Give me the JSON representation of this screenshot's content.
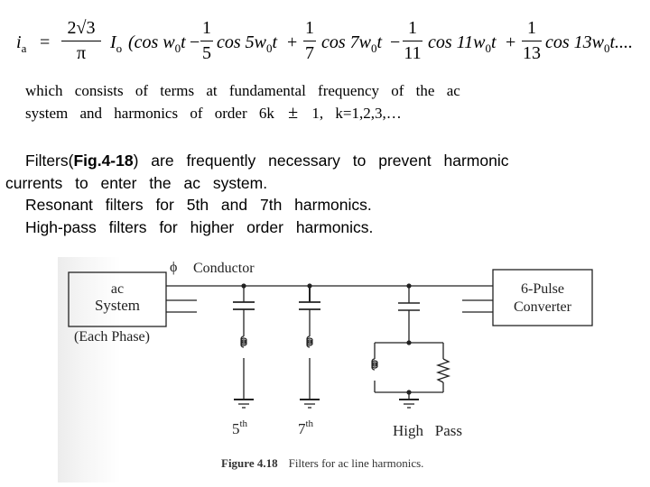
{
  "equation": {
    "lhs": "i",
    "lhs_sub": "a",
    "equals": "=",
    "coef_num": "2√3",
    "coef_den": "π",
    "amp": "I",
    "amp_sub": "o",
    "terms": [
      {
        "sign": "",
        "coef": null,
        "text": "(cos w",
        "harmonic": "",
        "tail": "t"
      },
      {
        "sign": "−",
        "coef": {
          "num": "1",
          "den": "5"
        },
        "text": "cos 5w",
        "tail": "t"
      },
      {
        "sign": "+",
        "coef": {
          "num": "1",
          "den": "7"
        },
        "text": "cos 7w",
        "tail": "t"
      },
      {
        "sign": "−",
        "coef": {
          "num": "1",
          "den": "11"
        },
        "text": "cos 11w",
        "tail": "t"
      },
      {
        "sign": "+",
        "coef": {
          "num": "1",
          "den": "13"
        },
        "text": "cos 13w",
        "tail": "t...."
      }
    ],
    "freq_sub": "0"
  },
  "paragraph1": {
    "line1": "which consists of terms at fundamental frequency of the ac",
    "line2_pre": "system and harmonics of order 6k",
    "pm": "±",
    "line2_post": "1, k=1,2,3,…"
  },
  "paragraph2": {
    "line1_pre": "Filters(",
    "line1_bold": "Fig.4-18",
    "line1_post": ")  are frequently necessary to prevent harmonic",
    "line2": "currents to enter the ac system.",
    "line3": "Resonant filters for 5th and 7th harmonics.",
    "line4": "High-pass filters for higher order harmonics."
  },
  "figure": {
    "phi_symbol": "ϕ",
    "conductor_label": "Conductor",
    "ac_system": {
      "line1": "ac",
      "line2": "System",
      "note": "(Each Phase)"
    },
    "converter": {
      "line1": "6-Pulse",
      "line2": "Converter"
    },
    "filters": [
      {
        "label": "5",
        "sup": "th",
        "type": "resonant"
      },
      {
        "label": "7",
        "sup": "th",
        "type": "resonant"
      },
      {
        "label": "High   Pass",
        "sup": "",
        "type": "high-pass"
      }
    ],
    "caption_bold": "Figure 4.18",
    "caption_text": "Filters for ac line harmonics."
  }
}
